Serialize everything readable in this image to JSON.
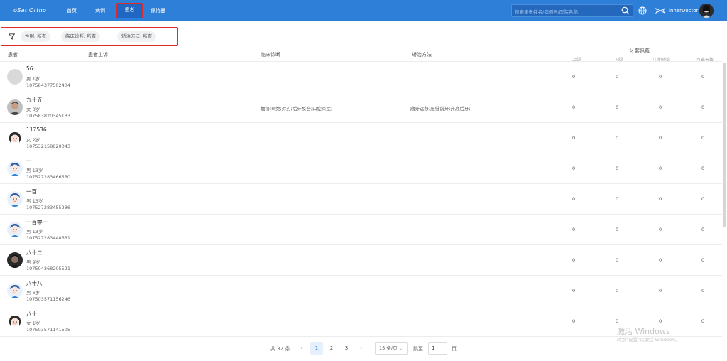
{
  "app": {
    "logo": "oSat Ortho",
    "nav": [
      "首页",
      "病例",
      "患者",
      "保持器"
    ],
    "active_nav": "患者",
    "search_placeholder": "搜索患者姓名/病例号/医院名称",
    "user": "innerDoctor",
    "colors": {
      "topbar": "#2d7fd8",
      "highlight": "#e02a2a"
    }
  },
  "filters": {
    "icon": "filter-icon",
    "chips": [
      "性别: 所有",
      "临床诊断: 所有",
      "矫治方法: 所有"
    ]
  },
  "table": {
    "headers": {
      "patient": "患者",
      "complaint": "患者主诉",
      "diagnosis": "临床诊断",
      "method": "矫治方法",
      "aligner_group": "牙套佩戴",
      "upper": "上颌",
      "lower": "下颌",
      "mid_ortho": "中期矫治",
      "wear_days": "可戴天数"
    },
    "rows": [
      {
        "name": "56",
        "sexage": "男  1岁",
        "id": "107584377502404",
        "complaint": "",
        "diagnosis": "",
        "method": "",
        "upper": "0",
        "lower": "0",
        "mid": "0",
        "days": "0",
        "avatar": "blank"
      },
      {
        "name": "九十五",
        "sexage": "女  3岁",
        "id": "107583820345133",
        "complaint": "",
        "diagnosis": "拥挤;III类;对刃;后牙反合;口腔炎症;",
        "method": "磨牙远移;压低前牙;升高后牙;",
        "upper": "0",
        "lower": "0",
        "mid": "0",
        "days": "0",
        "avatar": "photo-man"
      },
      {
        "name": "117536",
        "sexage": "女  2岁",
        "id": "107532158820043",
        "complaint": "",
        "diagnosis": "",
        "method": "",
        "upper": "0",
        "lower": "0",
        "mid": "0",
        "days": "0",
        "avatar": "girl"
      },
      {
        "name": "一",
        "sexage": "男  13岁",
        "id": "107527283466550",
        "complaint": "",
        "diagnosis": "",
        "method": "",
        "upper": "0",
        "lower": "0",
        "mid": "0",
        "days": "0",
        "avatar": "boy"
      },
      {
        "name": "一百",
        "sexage": "男  13岁",
        "id": "107527283455286",
        "complaint": "",
        "diagnosis": "",
        "method": "",
        "upper": "0",
        "lower": "0",
        "mid": "0",
        "days": "0",
        "avatar": "boy"
      },
      {
        "name": "一百零一",
        "sexage": "男  13岁",
        "id": "107527283448631",
        "complaint": "",
        "diagnosis": "",
        "method": "",
        "upper": "0",
        "lower": "0",
        "mid": "0",
        "days": "0",
        "avatar": "boy"
      },
      {
        "name": "八十二",
        "sexage": "男  9岁",
        "id": "107504368205521",
        "complaint": "",
        "diagnosis": "",
        "method": "",
        "upper": "0",
        "lower": "0",
        "mid": "0",
        "days": "0",
        "avatar": "photo-dark"
      },
      {
        "name": "八十八",
        "sexage": "男  6岁",
        "id": "107503571156246",
        "complaint": "",
        "diagnosis": "",
        "method": "",
        "upper": "0",
        "lower": "0",
        "mid": "0",
        "days": "0",
        "avatar": "boy"
      },
      {
        "name": "八十",
        "sexage": "女  1岁",
        "id": "107503571141505",
        "complaint": "",
        "diagnosis": "",
        "method": "",
        "upper": "0",
        "lower": "0",
        "mid": "0",
        "days": "0",
        "avatar": "girl"
      }
    ]
  },
  "pagination": {
    "total": "共 32 条",
    "pages": [
      "1",
      "2",
      "3"
    ],
    "current": "1",
    "page_size": "15 条/页",
    "jump_label": "跳至",
    "jump_value": "1",
    "page_suffix": "页"
  },
  "watermark": {
    "line1": "激活 Windows",
    "line2": "转到\"设置\"以激活 Windows。"
  }
}
